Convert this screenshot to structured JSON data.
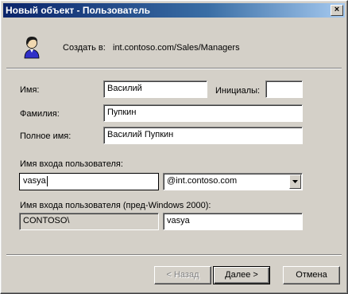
{
  "window": {
    "title": "Новый объект - Пользователь",
    "close_glyph": "×"
  },
  "header": {
    "icon": "user-icon",
    "create_in_label": "Создать в:",
    "create_in_path": "int.contoso.com/Sales/Managers"
  },
  "form": {
    "first_name": {
      "label": "Имя:",
      "value": "Василий"
    },
    "initials": {
      "label": "Инициалы:",
      "value": ""
    },
    "last_name": {
      "label": "Фамилия:",
      "value": "Пупкин"
    },
    "full_name": {
      "label": "Полное имя:",
      "value": "Василий Пупкин"
    },
    "logon_name": {
      "label": "Имя входа пользователя:",
      "value": "vasya",
      "domain_selected": "@int.contoso.com"
    },
    "logon_name_pre2000": {
      "label": "Имя входа пользователя (пред-Windows 2000):",
      "domain": "CONTOSO\\",
      "value": "vasya"
    }
  },
  "buttons": {
    "back": "< Назад",
    "next": "Далее >",
    "cancel": "Отмена"
  },
  "colors": {
    "face": "#d4d0c8",
    "title_start": "#0a246a",
    "title_end": "#a6caf0"
  }
}
